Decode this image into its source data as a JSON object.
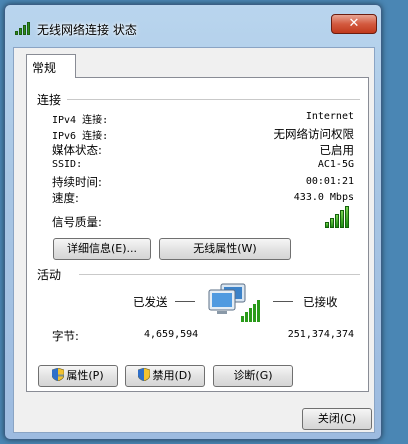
{
  "window": {
    "title": "无线网络连接 状态",
    "close_label": "✕"
  },
  "tabs": [
    {
      "label": "常规"
    }
  ],
  "connection": {
    "section_label": "连接",
    "rows": [
      {
        "label": "IPv4 连接:",
        "value": "Internet"
      },
      {
        "label": "IPv6 连接:",
        "value": "无网络访问权限"
      },
      {
        "label": "媒体状态:",
        "value": "已启用"
      },
      {
        "label": "SSID:",
        "value": "AC1-5G"
      },
      {
        "label": "持续时间:",
        "value": "00:01:21"
      },
      {
        "label": "速度:",
        "value": "433.0 Mbps"
      }
    ],
    "signal_label": "信号质量:",
    "signal_level": 5,
    "signal_max": 5,
    "details_button": "详细信息(E)...",
    "wireless_props_button": "无线属性(W)"
  },
  "activity": {
    "section_label": "活动",
    "sent_label": "已发送",
    "received_label": "已接收",
    "bytes_label": "字节:",
    "bytes_sent": "4,659,594",
    "bytes_received": "251,374,374"
  },
  "actions": {
    "properties_button": "属性(P)",
    "disable_button": "禁用(D)",
    "diagnose_button": "诊断(G)"
  },
  "footer": {
    "close_button": "关闭(C)"
  },
  "icons": {
    "title": "wireless-signal-icon",
    "shield": "uac-shield-icon",
    "computer": "network-computer-icon"
  },
  "colors": {
    "signal_green": "#1c8c12",
    "close_red": "#c0391c",
    "title_bar": "#a8c6e4"
  }
}
